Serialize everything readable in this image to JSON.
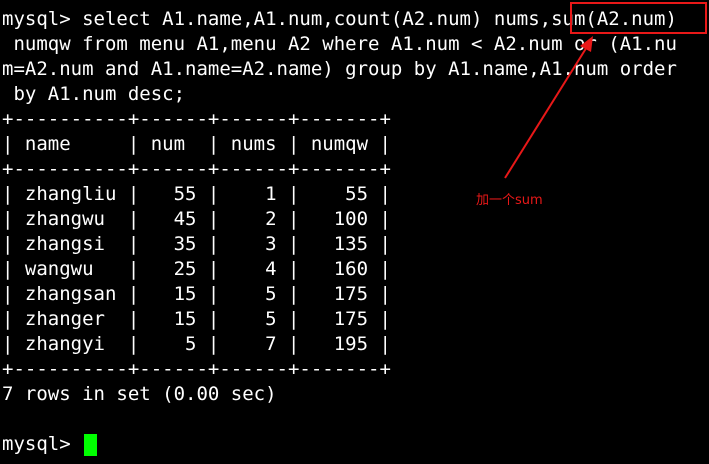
{
  "terminal": {
    "query_lines": [
      "mysql> select A1.name,A1.num,count(A2.num) nums,sum(A2.num)",
      " numqw from menu A1,menu A2 where A1.num < A2.num or (A1.nu",
      "m=A2.num and A1.name=A2.name) group by A1.name,A1.num order",
      " by A1.num desc;"
    ],
    "table": {
      "border_line": "+----------+------+------+-------+",
      "columns": [
        "name",
        "num",
        "nums",
        "numqw"
      ],
      "rows": [
        [
          "zhangliu",
          "55",
          "1",
          "55"
        ],
        [
          "zhangwu",
          "45",
          "2",
          "100"
        ],
        [
          "zhangsi",
          "35",
          "3",
          "135"
        ],
        [
          "wangwu",
          "25",
          "4",
          "160"
        ],
        [
          "zhangsan",
          "15",
          "5",
          "175"
        ],
        [
          "zhanger",
          "15",
          "5",
          "175"
        ],
        [
          "zhangyi",
          "5",
          "7",
          "195"
        ]
      ]
    },
    "result_text": "7 rows in set (0.00 sec)",
    "prompt": "mysql> "
  },
  "annotation": {
    "text": "加一个sum",
    "color": "#e81818"
  },
  "colors": {
    "background": "#000000",
    "text": "#ffffff",
    "cursor": "#00ff00"
  }
}
